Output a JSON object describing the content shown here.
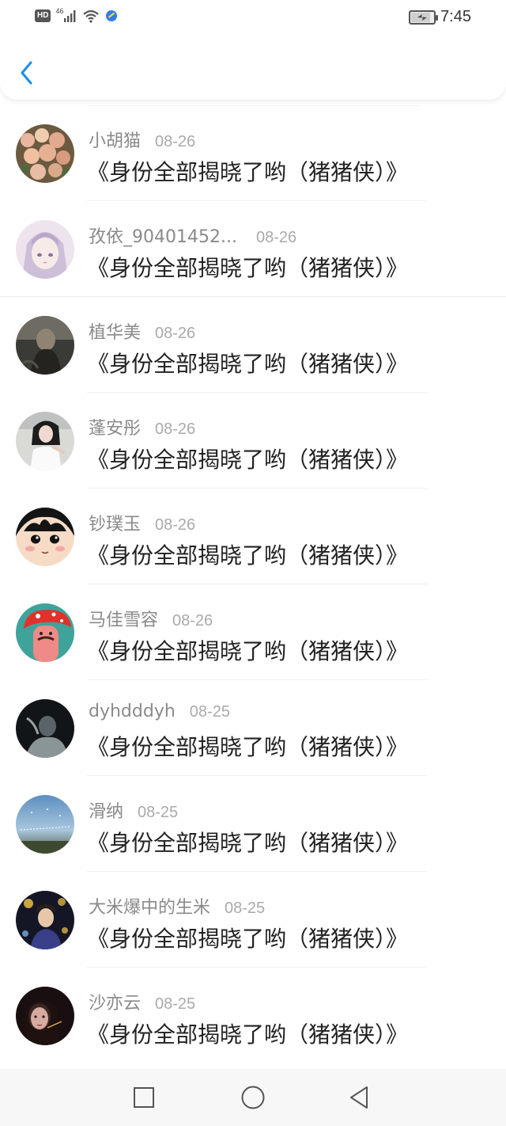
{
  "status_bar": {
    "hd": "HD",
    "network": "46",
    "time": "7:45",
    "battery_level": 0.85,
    "icons": [
      "signal-icon",
      "wifi-icon",
      "app-notification-icon",
      "battery-charging-icon"
    ]
  },
  "top_bar": {
    "back_icon": "chevron-left-icon",
    "accent": "#1a8fe8"
  },
  "items": [
    {
      "name": "小胡猫",
      "date": "08-26",
      "message": "《身份全部揭晓了哟（猪猪侠）》",
      "avatar": "flowers"
    },
    {
      "name": "孜依_90401452...",
      "date": "08-26",
      "message": "《身份全部揭晓了哟（猪猪侠）》",
      "avatar": "anime-girl"
    },
    {
      "name": "植华美",
      "date": "08-26",
      "message": "《身份全部揭晓了哟（猪猪侠）》",
      "avatar": "dark-figure"
    },
    {
      "name": "蓬安彤",
      "date": "08-26",
      "message": "《身份全部揭晓了哟（猪猪侠）》",
      "avatar": "girl-photo"
    },
    {
      "name": "钞璞玉",
      "date": "08-26",
      "message": "《身份全部揭晓了哟（猪猪侠）》",
      "avatar": "cartoon-face"
    },
    {
      "name": "马佳雪容",
      "date": "08-26",
      "message": "《身份全部揭晓了哟（猪猪侠）》",
      "avatar": "mushroom"
    },
    {
      "name": "dyhdddyh",
      "date": "08-25",
      "message": "《身份全部揭晓了哟（猪猪侠）》",
      "avatar": "dark-girl"
    },
    {
      "name": "滑纳",
      "date": "08-25",
      "message": "《身份全部揭晓了哟（猪猪侠）》",
      "avatar": "sky"
    },
    {
      "name": "大米爆中的生米",
      "date": "08-25",
      "message": "《身份全部揭晓了哟（猪猪侠）》",
      "avatar": "stage-lights"
    },
    {
      "name": "沙亦云",
      "date": "08-25",
      "message": "《身份全部揭晓了哟（猪猪侠）》",
      "avatar": "night-portrait"
    }
  ],
  "nav_bar": {
    "icons": [
      "recent-apps-icon",
      "home-icon",
      "back-triangle-icon"
    ]
  }
}
